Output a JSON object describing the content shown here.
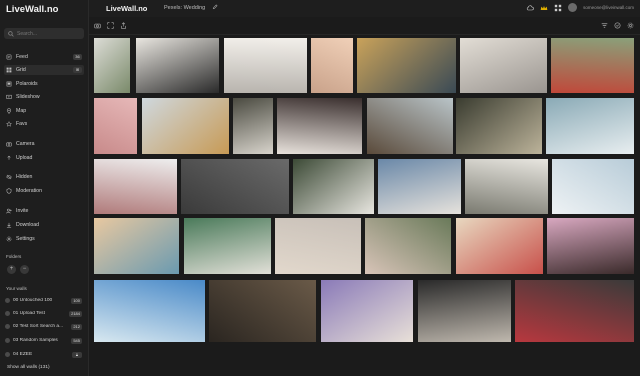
{
  "app": {
    "name": "LiveWall.no",
    "title": "LiveWall.no"
  },
  "breadcrumb": {
    "prefix": "Pexels:",
    "name": "Wedding"
  },
  "header": {
    "email": "someone@liveinwall.com"
  },
  "search": {
    "placeholder": "Search..."
  },
  "nav": {
    "items": [
      {
        "label": "Feed",
        "icon": "feed-icon",
        "badge": "36",
        "active": false
      },
      {
        "label": "Grid",
        "icon": "grid-icon",
        "badge": "",
        "active": true
      },
      {
        "label": "Polaroids",
        "icon": "polaroid-icon",
        "badge": "",
        "active": false
      },
      {
        "label": "Slideshow",
        "icon": "slideshow-icon",
        "badge": "",
        "active": false
      },
      {
        "label": "Map",
        "icon": "map-icon",
        "badge": "",
        "active": false
      },
      {
        "label": "Favs",
        "icon": "star-icon",
        "badge": "",
        "active": false
      },
      {
        "label": "Camera",
        "icon": "camera-icon",
        "badge": "",
        "active": false
      },
      {
        "label": "Upload",
        "icon": "upload-icon",
        "badge": "",
        "active": false
      },
      {
        "label": "Hidden",
        "icon": "eye-off-icon",
        "badge": "",
        "active": false
      },
      {
        "label": "Moderation",
        "icon": "shield-icon",
        "badge": "",
        "active": false
      },
      {
        "label": "Invite",
        "icon": "user-plus-icon",
        "badge": "",
        "active": false
      },
      {
        "label": "Download",
        "icon": "download-icon",
        "badge": "",
        "active": false
      },
      {
        "label": "Settings",
        "icon": "gear-icon",
        "badge": "",
        "active": false
      }
    ]
  },
  "folders": {
    "label": "Folders"
  },
  "walls": {
    "label": "Your walls",
    "items": [
      {
        "label": "00 Untouched 100",
        "count": "100"
      },
      {
        "label": "01 Upload Test",
        "count": "2184"
      },
      {
        "label": "02 Test Sort Search a...",
        "count": "212"
      },
      {
        "label": "03 Random Samples",
        "count": "545"
      },
      {
        "label": "04 EZEE",
        "count": ""
      }
    ],
    "show_all": "Show all walls (131)"
  },
  "colors": {
    "sidebar": "#1e1e1e",
    "background": "#1b1b1b",
    "accent": "#e0b000"
  },
  "photos": [
    {
      "alt": "bride with bouquet",
      "colors": [
        "#dcdcd6",
        "#7a8a6a"
      ]
    },
    {
      "alt": "couple holding bouquet",
      "colors": [
        "#e9e6e0",
        "#2a2a2a"
      ]
    },
    {
      "alt": "bridal shoes and bouquet",
      "colors": [
        "#f2efea",
        "#b8b4ae"
      ]
    },
    {
      "alt": "peach rose bouquet",
      "colors": [
        "#f0d0b8",
        "#c9a28a"
      ]
    },
    {
      "alt": "couple at sunset field",
      "colors": [
        "#c9a25a",
        "#3a4a55"
      ]
    },
    {
      "alt": "white table setting",
      "colors": [
        "#e2ddd5",
        "#9a9590"
      ]
    },
    {
      "alt": "wooden arrow sign ceremony",
      "colors": [
        "#8aa07a",
        "#c0483a"
      ]
    },
    {
      "alt": "pink roses close up",
      "colors": [
        "#e6b8b8",
        "#c88a8a"
      ]
    },
    {
      "alt": "couple by boat at sea",
      "colors": [
        "#cfd8de",
        "#c79a55"
      ]
    },
    {
      "alt": "groom and bride embracing",
      "colors": [
        "#4a4a40",
        "#d8d4cc"
      ]
    },
    {
      "alt": "cutting wedding cake",
      "colors": [
        "#3a2f2e",
        "#e8e2dc"
      ]
    },
    {
      "alt": "couple on lakeside dock",
      "colors": [
        "#b9c4c8",
        "#5a4a3a"
      ]
    },
    {
      "alt": "wedding sign on grass",
      "colors": [
        "#3a3c30",
        "#bcb39a"
      ]
    },
    {
      "alt": "bride reflection in water",
      "colors": [
        "#8aaab6",
        "#e8eef0"
      ]
    },
    {
      "alt": "rings with pink ribbon",
      "colors": [
        "#eeeeee",
        "#b07a7a"
      ]
    },
    {
      "alt": "two rings black and white",
      "colors": [
        "#6a6a6a",
        "#3a3a3a"
      ]
    },
    {
      "alt": "couple in suit and dress",
      "colors": [
        "#3c4a36",
        "#e8e6e0"
      ]
    },
    {
      "alt": "couple by mountain lake",
      "colors": [
        "#6a88a8",
        "#e6e2dc"
      ]
    },
    {
      "alt": "bride holding white bouquet",
      "colors": [
        "#e8e6e0",
        "#7a7a70"
      ]
    },
    {
      "alt": "bride arms raised",
      "colors": [
        "#b8ccd8",
        "#eef2f4"
      ]
    },
    {
      "alt": "dessert buffet table",
      "colors": [
        "#e8c8a0",
        "#6a9ab0"
      ]
    },
    {
      "alt": "couple in front of green wall",
      "colors": [
        "#4a7a5a",
        "#e2e0d8"
      ]
    },
    {
      "alt": "couple kissing soft tones",
      "colors": [
        "#c8c0b8",
        "#e2d8cc"
      ]
    },
    {
      "alt": "bride with flower bouquet",
      "colors": [
        "#6a7a5a",
        "#d8c4b8"
      ]
    },
    {
      "alt": "outdoor reception decor",
      "colors": [
        "#e8d8c0",
        "#c8504a"
      ]
    },
    {
      "alt": "pink flower table arrangement",
      "colors": [
        "#d8a8c0",
        "#3a2a2a"
      ]
    },
    {
      "alt": "beach ceremony setup",
      "colors": [
        "#4a8ac8",
        "#d8e8f0"
      ]
    },
    {
      "alt": "candle lit reception",
      "colors": [
        "#6a5a48",
        "#2a2520"
      ]
    },
    {
      "alt": "table with flower centerpiece",
      "colors": [
        "#8a7ab8",
        "#e8e0d8"
      ]
    },
    {
      "alt": "wedding invitation glasses",
      "colors": [
        "#2a2a2a",
        "#bfb8ae"
      ]
    },
    {
      "alt": "love you sign",
      "colors": [
        "#3a3a3a",
        "#b8383e"
      ]
    }
  ]
}
